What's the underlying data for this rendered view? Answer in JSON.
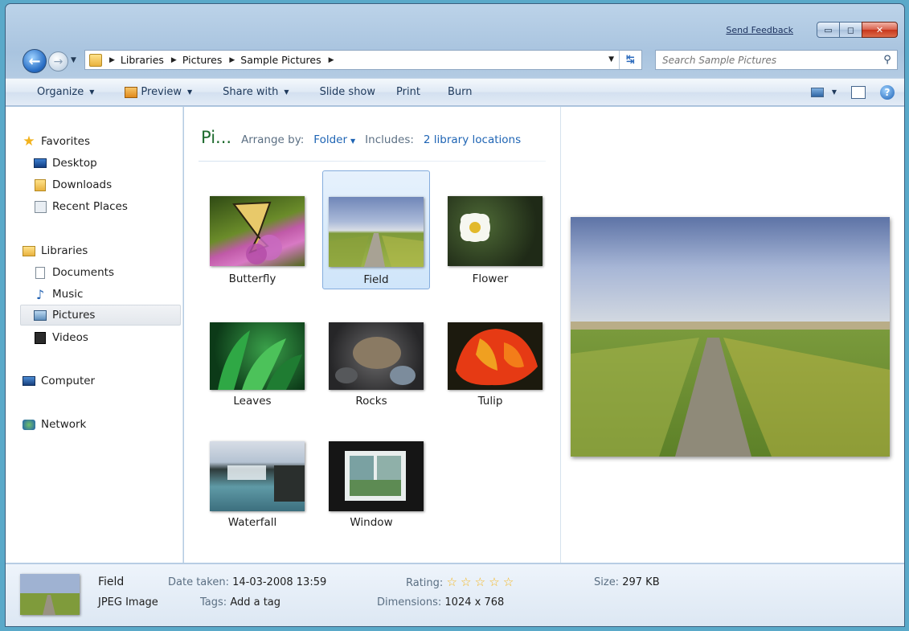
{
  "window": {
    "send_feedback": "Send Feedback",
    "caption": {
      "minimize": "▭",
      "maximize": "◻",
      "close": "✕"
    }
  },
  "address": {
    "crumbs": [
      "Libraries",
      "Pictures",
      "Sample Pictures"
    ],
    "icon": "folder-icon"
  },
  "search": {
    "placeholder": "Search Sample Pictures"
  },
  "toolbar": {
    "organize": "Organize",
    "preview": "Preview",
    "share_with": "Share with",
    "slide_show": "Slide show",
    "print": "Print",
    "burn": "Burn"
  },
  "sidebar": {
    "favorites": "Favorites",
    "desktop": "Desktop",
    "downloads": "Downloads",
    "recent_places": "Recent Places",
    "libraries": "Libraries",
    "documents": "Documents",
    "music": "Music",
    "pictures": "Pictures",
    "videos": "Videos",
    "computer": "Computer",
    "network": "Network"
  },
  "library": {
    "title": "Pi...",
    "arrange_label": "Arrange by:",
    "arrange_value": "Folder",
    "includes_label": "Includes:",
    "includes_value": "2 library locations"
  },
  "files": [
    {
      "name": "Butterfly"
    },
    {
      "name": "Field"
    },
    {
      "name": "Flower"
    },
    {
      "name": "Leaves"
    },
    {
      "name": "Rocks"
    },
    {
      "name": "Tulip"
    },
    {
      "name": "Waterfall"
    },
    {
      "name": "Window"
    }
  ],
  "details": {
    "name": "Field",
    "type": "JPEG Image",
    "date_label": "Date taken:",
    "date_value": "14-03-2008 13:59",
    "tags_label": "Tags:",
    "tags_value": "Add a tag",
    "rating_label": "Rating:",
    "dimensions_label": "Dimensions:",
    "dimensions_value": "1024 x 768",
    "size_label": "Size:",
    "size_value": "297 KB",
    "rating_stars": 0
  },
  "colors": {
    "accent": "#1e64b4",
    "library_title": "#1e6b2e",
    "selection": "#cfe5fa"
  }
}
